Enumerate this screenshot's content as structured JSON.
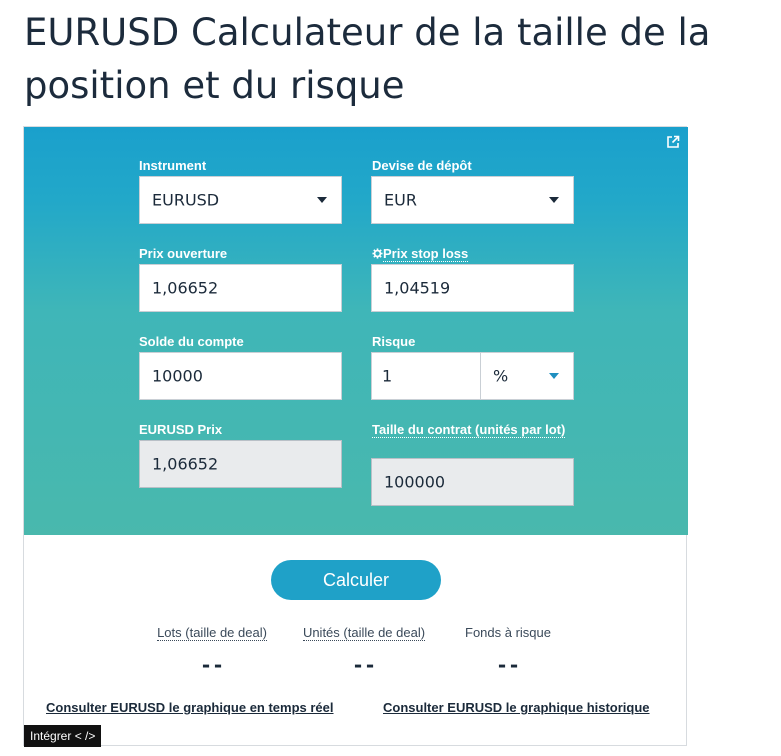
{
  "page": {
    "title": "EURUSD Calculateur de la taille de la position et du risque"
  },
  "form": {
    "instrument": {
      "label": "Instrument",
      "value": "EURUSD"
    },
    "deposit_currency": {
      "label": "Devise de dépôt",
      "value": "EUR"
    },
    "open_price": {
      "label": "Prix ouverture",
      "value": "1,06652"
    },
    "stop_loss": {
      "label": "Prix stop loss",
      "icon": "gear-icon",
      "value": "1,04519"
    },
    "account_balance": {
      "label": "Solde du compte",
      "value": "10000"
    },
    "risk": {
      "label": "Risque",
      "value": "1",
      "unit": "%"
    },
    "pair_price": {
      "label": "EURUSD Prix",
      "value": "1,06652"
    },
    "contract_size": {
      "label": "Taille du contrat (unités par lot)",
      "value": "100000"
    }
  },
  "actions": {
    "calculate_label": "Calculer",
    "embed_label": "Intégrer < />"
  },
  "results": [
    {
      "label": "Lots (taille de deal)",
      "value": "--"
    },
    {
      "label": "Unités (taille de deal)",
      "value": "--"
    },
    {
      "label": "Fonds à risque",
      "value": "--"
    }
  ],
  "links": {
    "realtime_chart": "Consulter EURUSD le graphique en temps réel",
    "historical_chart": "Consulter EURUSD le graphique historique"
  },
  "colors": {
    "gradient_top": "#1aa0cc",
    "gradient_bottom": "#49b8ad",
    "button": "#1fa1c8"
  }
}
